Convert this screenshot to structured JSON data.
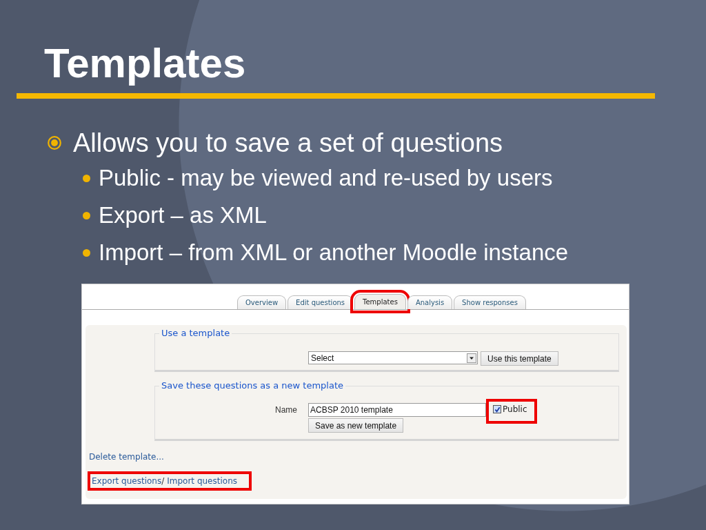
{
  "slide": {
    "title": "Templates",
    "bullets": [
      {
        "text": "Allows you to save a set of questions",
        "children": [
          {
            "text": "Public - may be viewed and re-used by users"
          },
          {
            "text": "Export – as XML"
          },
          {
            "text": "Import – from XML or another Moodle instance"
          }
        ]
      }
    ]
  },
  "screenshot": {
    "tabs": [
      {
        "label": "Overview",
        "selected": false,
        "highlighted": false
      },
      {
        "label": "Edit questions",
        "selected": false,
        "highlighted": false
      },
      {
        "label": "Templates",
        "selected": true,
        "highlighted": true
      },
      {
        "label": "Analysis",
        "selected": false,
        "highlighted": false
      },
      {
        "label": "Show responses",
        "selected": false,
        "highlighted": false
      }
    ],
    "use_template": {
      "legend": "Use a template",
      "select_value": "Select",
      "button": "Use this template"
    },
    "save_template": {
      "legend": "Save these questions as a new template",
      "name_label": "Name",
      "name_value": "ACBSP 2010 template",
      "public": {
        "label": "Public",
        "checked": true,
        "highlighted": true
      },
      "button": "Save as new template"
    },
    "delete_link": "Delete template...",
    "links": {
      "highlighted": true,
      "export": "Export questions",
      "separator": "/",
      "import": "Import questions"
    }
  }
}
